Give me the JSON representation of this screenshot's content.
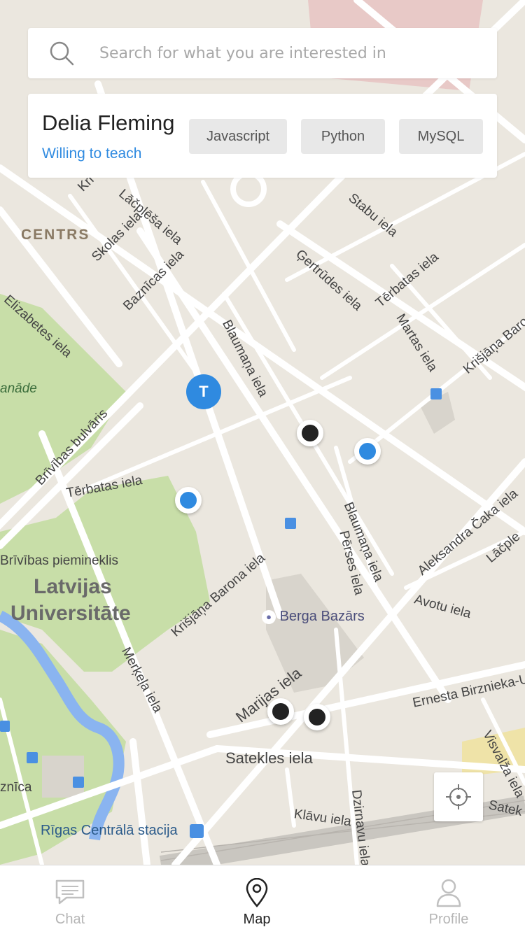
{
  "search": {
    "placeholder": "Search for what you are interested in"
  },
  "profile_card": {
    "name": "Delia Fleming",
    "subtitle": "Willing to teach",
    "skills": [
      "Javascript",
      "Python",
      "MySQL"
    ]
  },
  "map": {
    "labels": {
      "centrs": "CENTRS",
      "skolas": "Skolas iela",
      "baznicas": "Baznīcas iela",
      "elizabetes": "Elizabetes iela",
      "aspazijas": "anāde",
      "brivibas": "Brīvības bulvāris",
      "terbatas_left": "Tērbatas iela",
      "brivibas_piem": "Brīvības piemineklis",
      "latvijas": "Latvijas",
      "universitate": "Universitāte",
      "merkela": "Merķeļa iela",
      "blaumana_top": "Blaumaņa iela",
      "blaumana_bottom": "Blaumaņa iela",
      "perses": "Pērses iela",
      "krisjana_barona": "Krišjāņa Barona iela",
      "krisjana_barona_right": "Krišjāņa Baro",
      "aleksandra": "Aleksandra Čaka iela",
      "lacples_right": "Lāčple",
      "avotu": "Avotu iela",
      "marijas": "Marijas iela",
      "ernesta": "Ernesta Birznieka-U",
      "satekles": "Satekles iela",
      "satek_right": "Satek",
      "visvalza": "Visvalža iela",
      "klavu": "Klāvu iela",
      "dzirnavu": "Dzirnavu iela",
      "rigas": "Rīgas Centrālā stacija",
      "znica": "znīca",
      "stabu": "Stabu iela",
      "gertrudes": "Ģertrūdes iela",
      "terbatas_right": "Tērbatas iela",
      "martas": "Martas iela",
      "lacplesa": "Lāčplēša iela",
      "krisjana_top": "Kri",
      "berga": "Berga Bazārs"
    },
    "teacher_pin_label": "T"
  },
  "tabs": [
    {
      "label": "Chat",
      "icon": "chat-icon",
      "active": false
    },
    {
      "label": "Map",
      "icon": "map-pin-icon",
      "active": true
    },
    {
      "label": "Profile",
      "icon": "profile-icon",
      "active": false
    }
  ],
  "colors": {
    "accent": "#2f8ae0",
    "map_bg": "#ebe7df",
    "park": "#c8dea8",
    "water": "#8ab4f0",
    "road": "#ffffff"
  }
}
